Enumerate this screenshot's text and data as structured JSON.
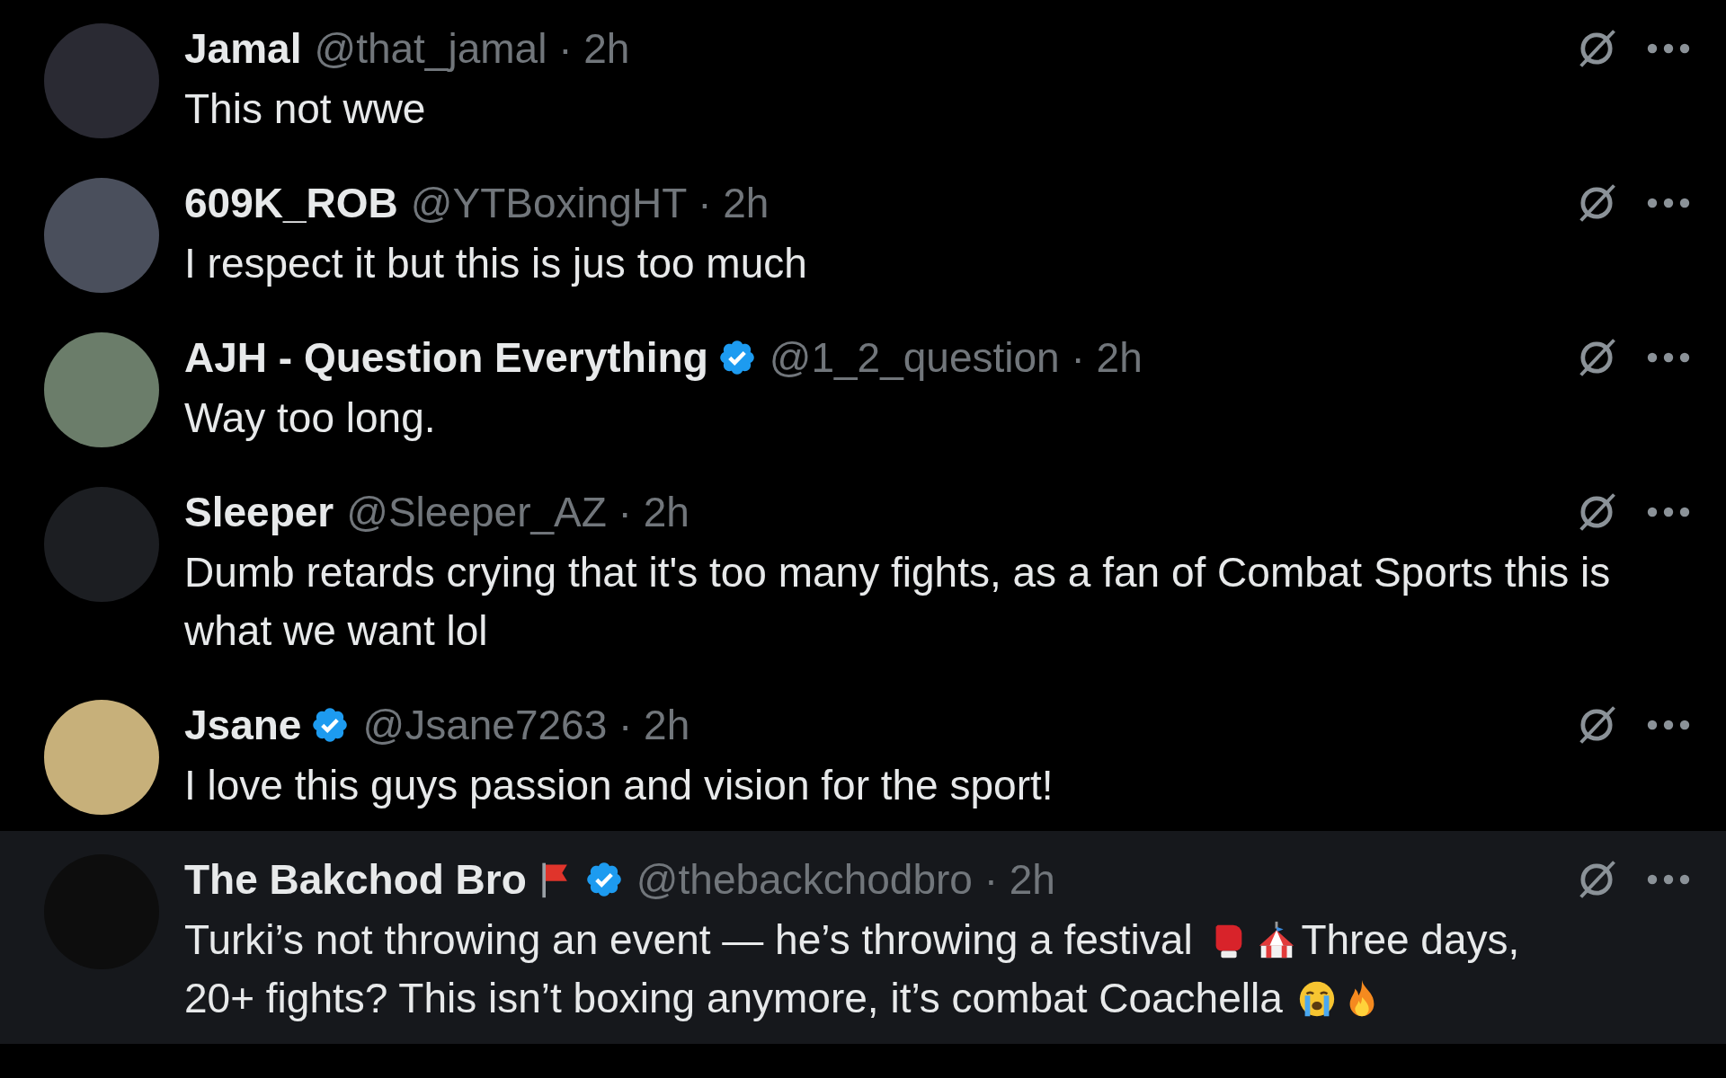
{
  "replies": [
    {
      "name": "Jamal",
      "handle": "@that_jamal",
      "separator": "·",
      "time": "2h",
      "verified": false,
      "highlighted": false,
      "body": [
        {
          "kind": "text",
          "text": "This not wwe"
        }
      ]
    },
    {
      "name": "609K_ROB",
      "handle": "@YTBoxingHT",
      "separator": "·",
      "time": "2h",
      "verified": false,
      "highlighted": false,
      "body": [
        {
          "kind": "text",
          "text": "I respect it but this is jus too much"
        }
      ]
    },
    {
      "name": "AJH - Question Everything",
      "handle": "@1_2_question",
      "separator": "·",
      "time": "2h",
      "verified": true,
      "highlighted": false,
      "body": [
        {
          "kind": "text",
          "text": "Way too long."
        }
      ]
    },
    {
      "name": "Sleeper",
      "handle": "@Sleeper_AZ",
      "separator": "·",
      "time": "2h",
      "verified": false,
      "highlighted": false,
      "body": [
        {
          "kind": "text",
          "text": "Dumb retards crying that it's too many fights, as a fan of Combat Sports this is what we want lol"
        }
      ]
    },
    {
      "name": "Jsane",
      "handle": "@Jsane7263",
      "separator": "·",
      "time": "2h",
      "verified": true,
      "highlighted": false,
      "body": [
        {
          "kind": "text",
          "text": "I love this guys passion and vision for the sport!"
        }
      ]
    },
    {
      "name": "The Bakchod Bro",
      "handle": "@thebackchodbro",
      "separator": "·",
      "time": "2h",
      "verified": true,
      "flag": true,
      "highlighted": true,
      "body": [
        {
          "kind": "text",
          "text": "Turki’s not throwing an event — he’s throwing a festival"
        },
        {
          "kind": "glove"
        },
        {
          "kind": "tent"
        },
        {
          "kind": "text",
          "text": "Three days,"
        },
        {
          "kind": "text",
          "text": "20+ fights? This isn’t boxing anymore, it’s combat Coachella"
        },
        {
          "kind": "crying"
        },
        {
          "kind": "fire"
        }
      ]
    }
  ]
}
